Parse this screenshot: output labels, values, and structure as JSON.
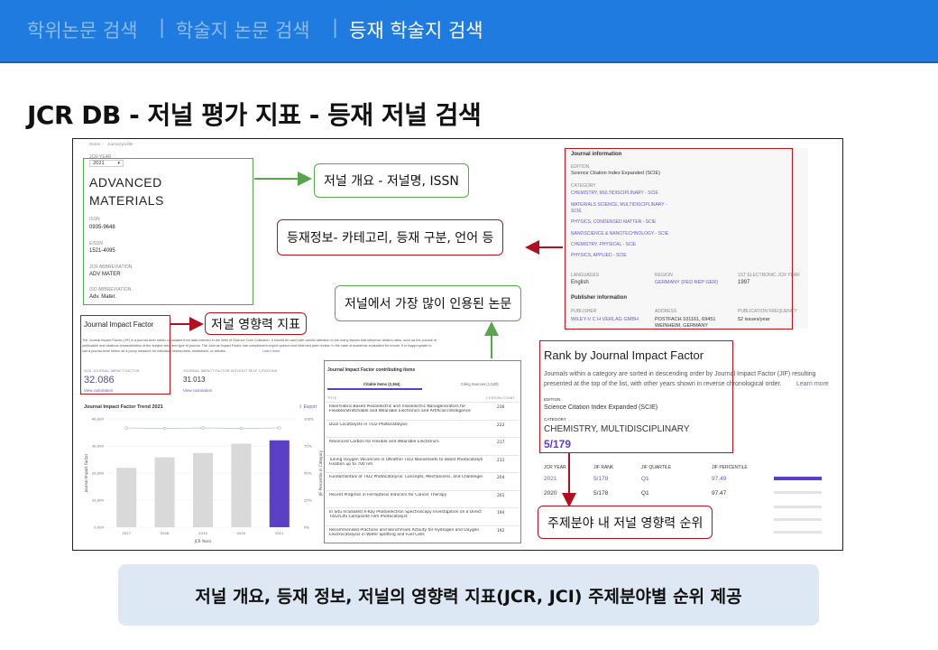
{
  "tabs": [
    {
      "label": "학위논문 검색"
    },
    {
      "label": "학술지 논문 검색"
    },
    {
      "label": "등재 학술지 검색"
    }
  ],
  "tab_separator": "|",
  "page_title": "JCR DB -  저널 평가 지표  -  등재 저널 검색",
  "profile": {
    "breadcrumb_home": "Home",
    "breadcrumb_sep": "›",
    "breadcrumb_page": "Journal profile",
    "jcr_year_label": "JCR YEAR",
    "jcr_year_value": "2021",
    "journal_name_line1": "ADVANCED",
    "journal_name_line2": "MATERIALS",
    "issn_label": "ISSN",
    "issn": "0935-9648",
    "eissn_label": "EISSN",
    "eissn": "1521-4095",
    "abbr_label": "JCR ABBREVIATION",
    "abbr": "ADV MATER",
    "iso_label": "ISO ABBREVIATION",
    "iso": "Adv. Mater."
  },
  "journal_info": {
    "heading": "Journal information",
    "edition_label": "EDITION",
    "edition": "Science Citation Index Expanded (SCIE)",
    "category_label": "CATEGORY",
    "categories": [
      "CHEMISTRY, MULTIDISCIPLINARY - SCIE",
      "MATERIALS SCIENCE, MULTIDISCIPLINARY -",
      "SCIE",
      "PHYSICS, CONDENSED MATTER - SCIE",
      "NANOSCIENCE & NANOTECHNOLOGY - SCIE",
      "CHEMISTRY, PHYSICAL - SCIE",
      "PHYSICS, APPLIED - SCIE"
    ],
    "languages_label": "LANGUAGES",
    "language": "English",
    "region_label": "REGION",
    "region": "GERMANY (FED REP GER)",
    "first_year_label": "1ST ELECTRONIC JCR YEAR",
    "first_year": "1997",
    "publisher_heading": "Publisher information",
    "publisher_label": "PUBLISHER",
    "publisher": "WILEY-V C H VERLAG GMBH",
    "address_label": "ADDRESS",
    "address_line1": "POSTFACH 101161, 69451",
    "address_line2": "WEINHEIM, GERMANY",
    "frequency_label": "PUBLICATION FREQUENCY",
    "frequency": "52 issues/year"
  },
  "jif": {
    "heading": "Journal Impact Factor",
    "description_line1": "The Journal Impact Factor (JIF) is a journal-level metric calculated from data indexed in the Web of Science Core Collection. It should be used with careful attention to the many factors that influence citation rates, such as the volume of",
    "description_line2": "publication and citations characteristics of the subject area and type of journal. The Journal Impact Factor can complement expert opinion and informed peer review. In the case of academic evaluation for tenure, it is inappropriate to",
    "description_line3": "use a journal-level metric as a proxy measure for individual researchers, institutions, or articles.",
    "learn_more": "Learn more",
    "value_label": "2021 JOURNAL IMPACT FACTOR",
    "value": "32.086",
    "view_calc": "View calculation",
    "wo_label": "JOURNAL IMPACT FACTOR WITHOUT SELF CITATIONS",
    "wo_value": "31.013",
    "wo_view_calc": "View calculation"
  },
  "trend": {
    "title": "Journal Impact Factor Trend 2021",
    "export": "Export"
  },
  "chart_data": {
    "type": "bar",
    "categories": [
      "2017",
      "2018",
      "2019",
      "2020",
      "2021"
    ],
    "values": [
      21.95,
      25.81,
      27.4,
      30.85,
      32.09
    ],
    "ylim": [
      0,
      40
    ],
    "y_ticks": [
      "40,000",
      "30,000",
      "20,000",
      "10,000",
      "0.000"
    ],
    "y2_ticks": [
      "100%",
      "75%",
      "50%",
      "25%",
      "0%"
    ],
    "ylabel": "Journal Impact Factor",
    "y2label": "JIF Percentile in Category",
    "xlabel": "JCR Years",
    "highlight_color": "#5b3fc4",
    "bar_color": "#d9d9d9"
  },
  "items": {
    "heading": "Journal Impact Factor contributing items",
    "tab1": "Citable items (2,364)",
    "tab2": "Citing Sources (1,530)",
    "col_title": "TITLE",
    "col_count": "CITATION COUNT",
    "rows": [
      {
        "t1": "Fiber/Fabric-Based Piezoelectric and Triboelectric Nanogenerators for",
        "t2": "Flexible/Stretchable and Wearable Electronics and Artificial Intelligence",
        "c": "236"
      },
      {
        "t1": "Dual Cocatalysts in TiO2 Photocatalysis",
        "t2": "",
        "c": "222"
      },
      {
        "t1": "Advanced Carbon for Flexible and Wearable Electronics",
        "t2": "",
        "c": "217"
      },
      {
        "t1": "Tuning Oxygen Vacancies in Ultrathin TiO2 Nanosheets to Boost Photocatalytic Nitrogen",
        "t2": "Fixation up to 700 nm",
        "c": "211"
      },
      {
        "t1": "Fundamentals of TiO2 Photocatalysis: Concepts, Mechanisms, and Challenges",
        "t2": "",
        "c": "204"
      },
      {
        "t1": "Recent Progress in Ferroptosis Inducers for Cancer Therapy",
        "t2": "",
        "c": "201"
      },
      {
        "t1": "In Situ Irradiated X-Ray Photoelectron Spectroscopy Investigation on a Direct Z-Scheme",
        "t2": "TiO2/CdS Composite Film Photocatalyst",
        "c": "194"
      },
      {
        "t1": "Recommended Practices and Benchmark Activity for Hydrogen and Oxygen",
        "t2": "Electrocatalysis in Water Splitting and Fuel Cells",
        "c": "192"
      }
    ]
  },
  "rank": {
    "heading": "Rank by Journal Impact Factor",
    "desc_line1": "Journals within a category are sorted in descending order by Journal Impact Factor (JIF) resulting",
    "desc_line2": "presented at the top of the list, with other years shown in reverse chronological order.",
    "learn_more": "Learn more",
    "edition_label": "EDITION",
    "edition": "Science Citation Index Expanded (SCIE)",
    "category_label": "CATEGORY",
    "category": "CHEMISTRY, MULTIDISCIPLINARY",
    "rank_value": "5/179",
    "cols": [
      "JCR YEAR",
      "JIF RANK",
      "JIF QUARTILE",
      "JIF PERCENTILE"
    ],
    "rows": [
      {
        "year": "2021",
        "rank": "5/179",
        "q": "Q1",
        "p": "97.49"
      },
      {
        "year": "2020",
        "rank": "5/178",
        "q": "Q1",
        "p": "97.47"
      }
    ]
  },
  "callouts": {
    "overview": "저널 개요 - 저널명, ISSN",
    "info": "등재정보- 카테고리, 등재 구분, 언어 등",
    "impact": "저널 영향력 지표",
    "cited": "저널에서 가장 많이 인용된 논문",
    "rank": "주제분야 내 저널 영향력 순위"
  },
  "summary": "저널 개요, 등재 정보, 저널의 영향력 지표(JCR, JCI) 주제분야별 순위 제공",
  "colors": {
    "topbar": "#1f7be0",
    "red": "#c0121b",
    "green": "#58a64a",
    "purple": "#5b3fc4"
  }
}
